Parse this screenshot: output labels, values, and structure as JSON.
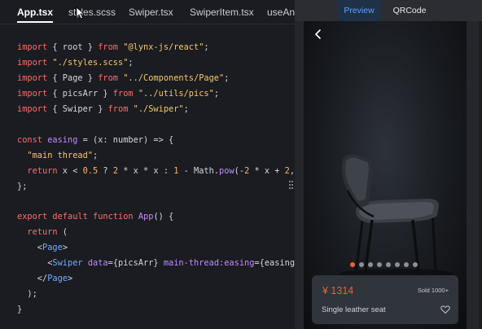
{
  "editor": {
    "tabs": [
      {
        "label": "App.tsx",
        "active": true
      },
      {
        "label": "styles.scss",
        "active": false
      },
      {
        "label": "Swiper.tsx",
        "active": false
      },
      {
        "label": "SwiperItem.tsx",
        "active": false
      },
      {
        "label": "useAn",
        "active": false
      }
    ],
    "code_lines": [
      [
        "import",
        " { root } ",
        "from",
        " ",
        "\"@lynx-js/react\"",
        ";"
      ],
      [
        "import",
        " ",
        "\"./styles.scss\"",
        ";"
      ],
      [
        "import",
        " { Page } ",
        "from",
        " ",
        "\"../Components/Page\"",
        ";"
      ],
      [
        "import",
        " { picsArr } ",
        "from",
        " ",
        "\"../utils/pics\"",
        ";"
      ],
      [
        "import",
        " { Swiper } ",
        "from",
        " ",
        "\"./Swiper\"",
        ";"
      ],
      [
        "const",
        " ",
        "easing",
        " = (x: number) => {"
      ],
      [
        "  ",
        "\"main thread\"",
        ";"
      ],
      [
        "  ",
        "return",
        " x < ",
        "0.5",
        " ? ",
        "2",
        " * x * x : ",
        "1",
        " - Math.",
        "pow",
        "(-",
        "2",
        " * x + ",
        "2",
        ","
      ],
      [
        "};"
      ],
      [
        "export",
        " ",
        "default",
        " ",
        "function",
        " ",
        "App",
        "() {"
      ],
      [
        "  ",
        "return",
        " ("
      ],
      [
        "    <",
        "Page",
        ">"
      ],
      [
        "      <",
        "Swiper",
        " ",
        "data",
        "={picsArr} ",
        "main-thread:easing",
        "={easing"
      ],
      [
        "    </",
        "Page",
        ">"
      ],
      [
        "  );"
      ],
      [
        "}"
      ]
    ]
  },
  "preview": {
    "tabs": [
      {
        "label": "Preview",
        "active": true
      },
      {
        "label": "QRCode",
        "active": false
      }
    ],
    "dot_count": 8,
    "active_dot": 0,
    "product": {
      "price": "¥ 1314",
      "sold": "Sold 1000+",
      "name": "Single leather seat"
    }
  }
}
